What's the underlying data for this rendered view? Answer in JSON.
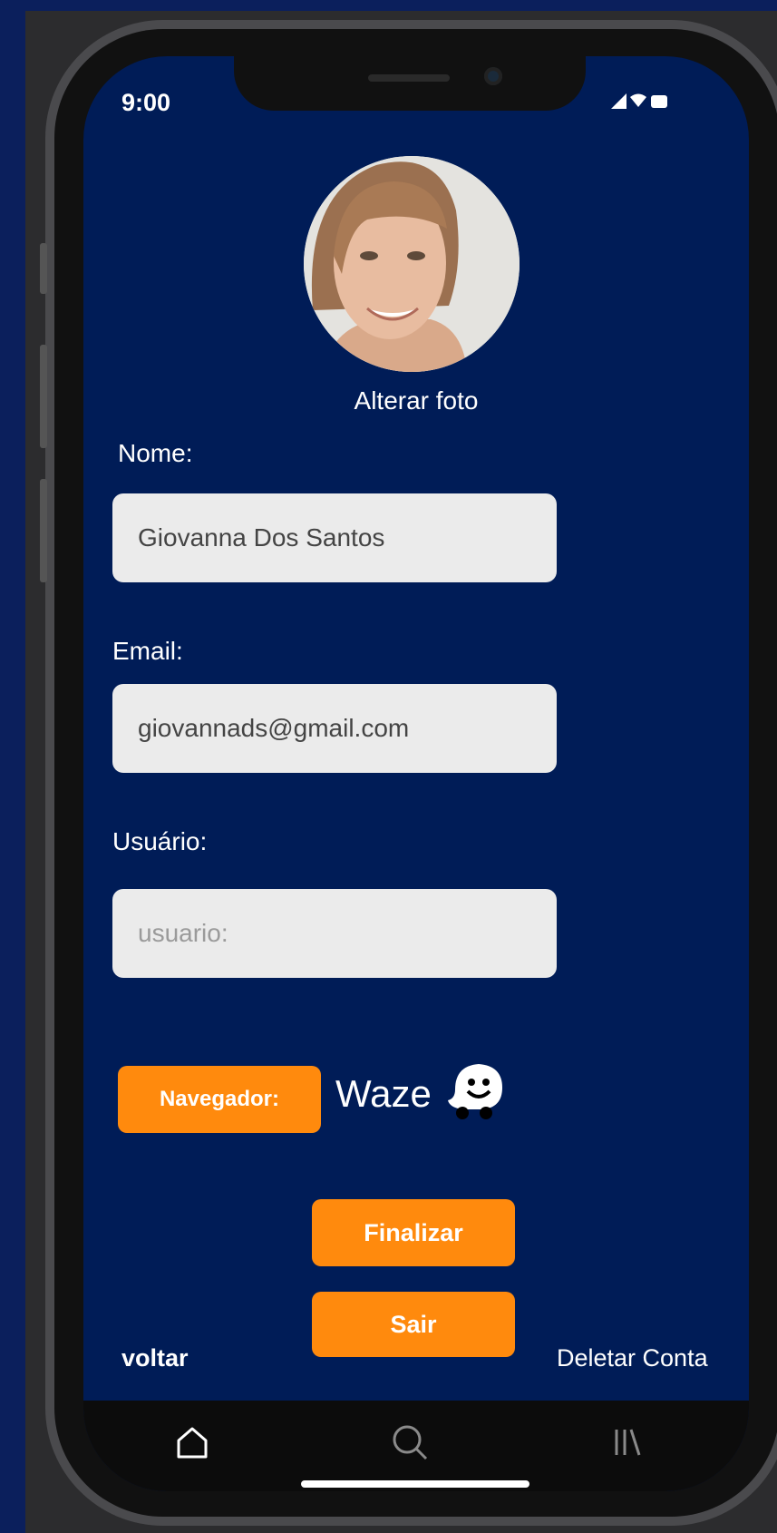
{
  "status_bar": {
    "time": "9:00"
  },
  "profile": {
    "change_photo_label": "Alterar foto"
  },
  "form": {
    "name_label": "Nome:",
    "name_value": "Giovanna Dos Santos",
    "email_label": "Email:",
    "email_value": "giovannads@gmail.com",
    "user_label": "Usuário:",
    "user_placeholder": "usuario:"
  },
  "navigator": {
    "label": "Navegador:",
    "value": "Waze",
    "icon": "waze-icon"
  },
  "actions": {
    "finalize_label": "Finalizar",
    "exit_label": "Sair"
  },
  "footer_links": {
    "back_label": "voltar",
    "delete_label": "Deletar Conta"
  },
  "tabbar": {
    "icons": [
      "home-icon",
      "search-icon",
      "library-icon"
    ]
  },
  "colors": {
    "screen_bg": "#001c57",
    "accent": "#ff8a0d",
    "field_bg": "#ebebeb",
    "page_bg": "#0b1f5c"
  }
}
